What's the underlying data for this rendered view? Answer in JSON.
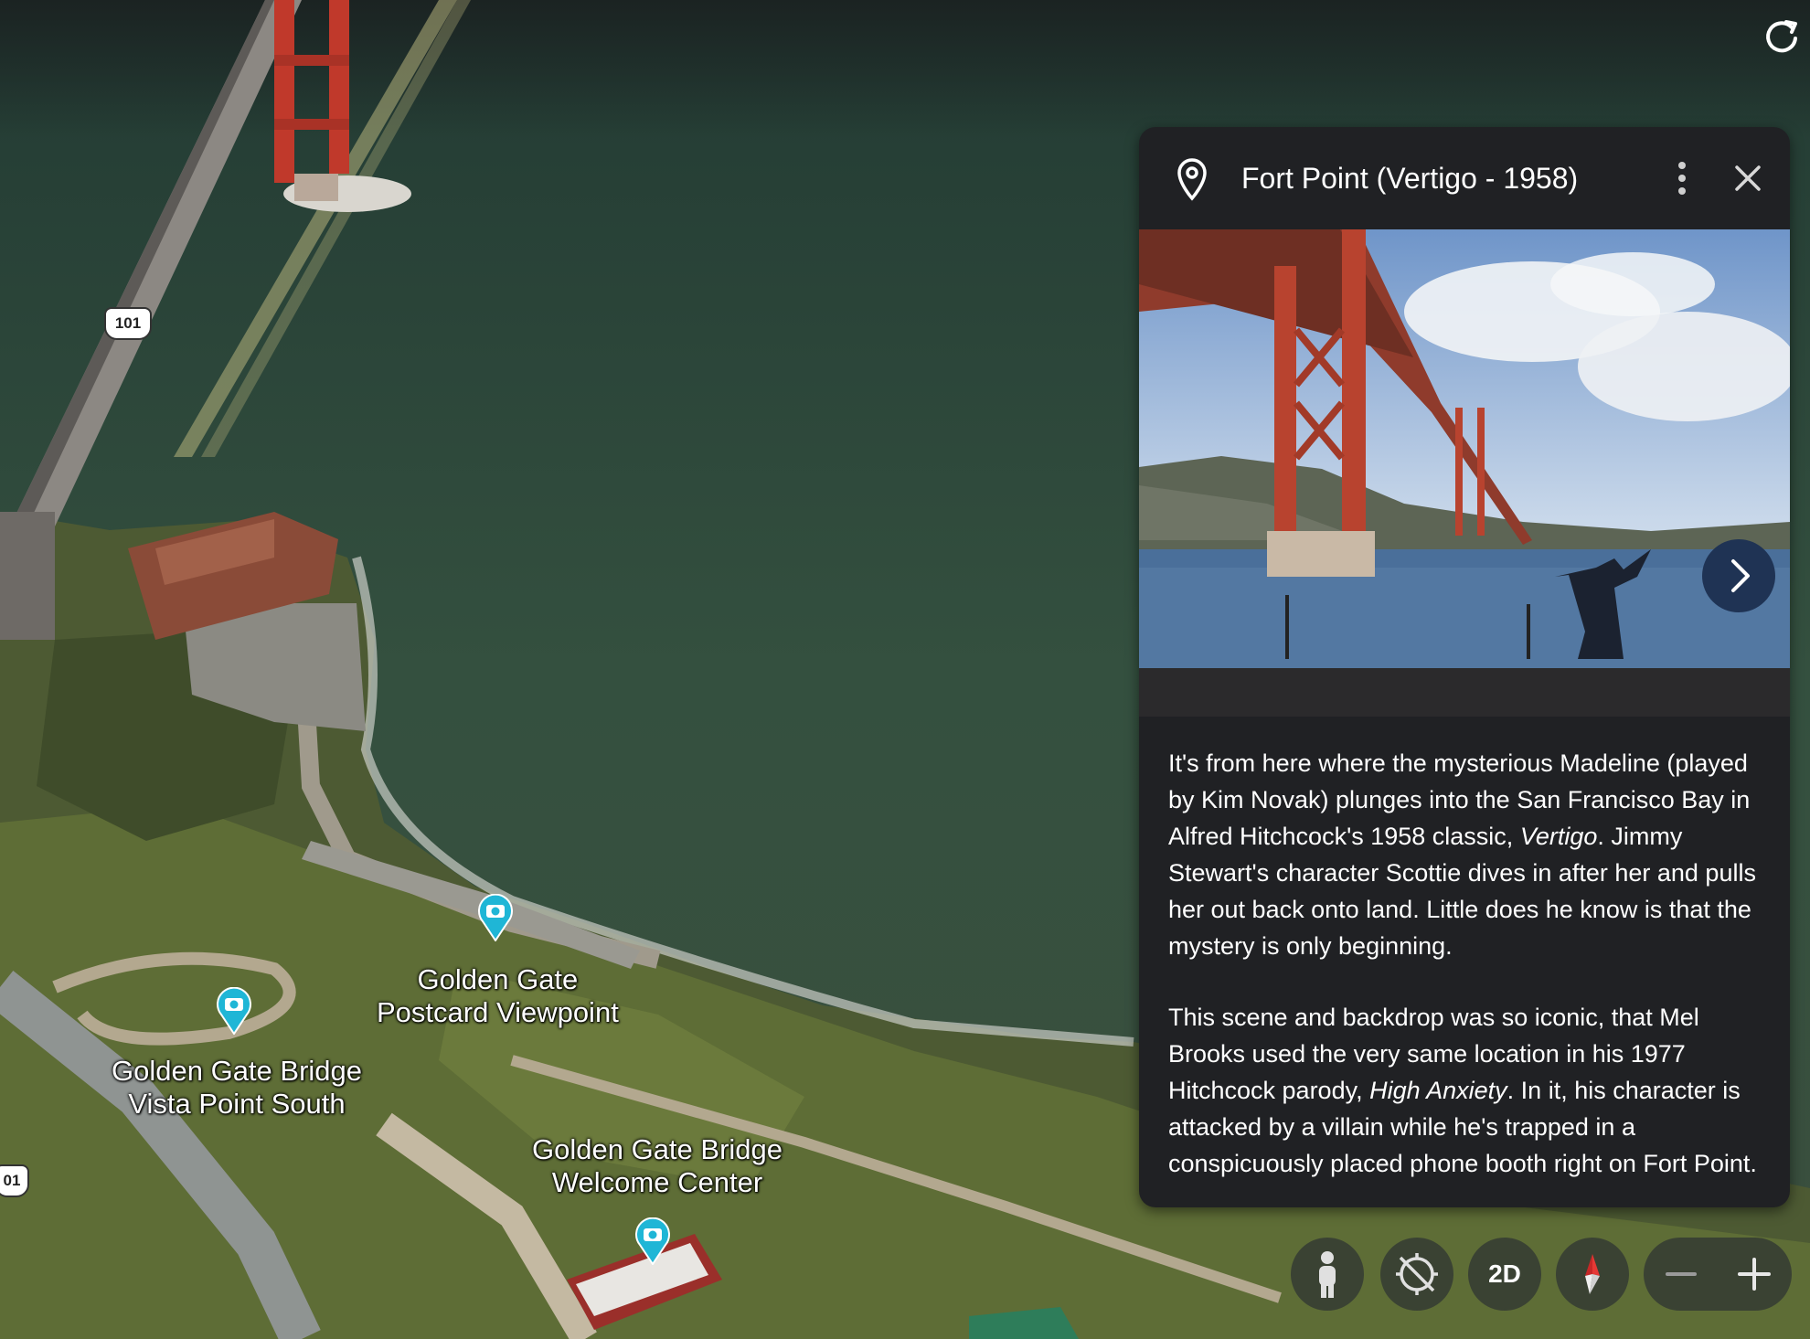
{
  "map": {
    "route_shield_1": "101",
    "route_shield_2": "01",
    "places": [
      {
        "name_line1": "Golden Gate",
        "name_line2": "Postcard Viewpoint",
        "icon": "camera-pin-icon"
      },
      {
        "name_line1": "Golden Gate Bridge",
        "name_line2": "Vista Point South",
        "icon": "camera-pin-icon"
      },
      {
        "name_line1": "Golden Gate Bridge",
        "name_line2": "Welcome Center",
        "icon": "camera-pin-icon"
      }
    ]
  },
  "top_right": {
    "icon": "refresh-icon"
  },
  "panel": {
    "title": "Fort Point (Vertigo - 1958)",
    "icons": {
      "place": "place-pin-icon",
      "more": "more-vertical-icon",
      "close": "close-icon",
      "next": "chevron-right-icon"
    },
    "photo_alt": "Golden Gate Bridge seen from Fort Point with a figure on the seawall",
    "paragraph1_a": "It's from here where the mysterious Madeline (played by Kim Novak) plunges into the San Francisco Bay in Alfred Hitchcock's 1958 classic, ",
    "paragraph1_italic": "Vertigo",
    "paragraph1_b": ". Jimmy Stewart's character Scottie dives in after her and pulls her out back onto land. Little does he know is that the mystery is only beginning.",
    "paragraph2_a": "This scene and backdrop was so iconic, that Mel Brooks used the very same location in his 1977 Hitchcock parody, ",
    "paragraph2_italic": "High Anxiety",
    "paragraph2_b": ". In it, his character is attacked by a villain while he's trapped in a conspicuously placed phone booth right on Fort Point."
  },
  "controls": {
    "pegman_icon": "pegman-icon",
    "tilt_icon": "tilt-off-icon",
    "view_toggle_label": "2D",
    "compass_icon": "compass-icon",
    "zoom_out_icon": "minus-icon",
    "zoom_in_icon": "plus-icon"
  },
  "colors": {
    "panel_bg": "#202124",
    "next_button": "#1f3354",
    "marker": "#1fb6d6",
    "bridge": "#c0392b"
  }
}
